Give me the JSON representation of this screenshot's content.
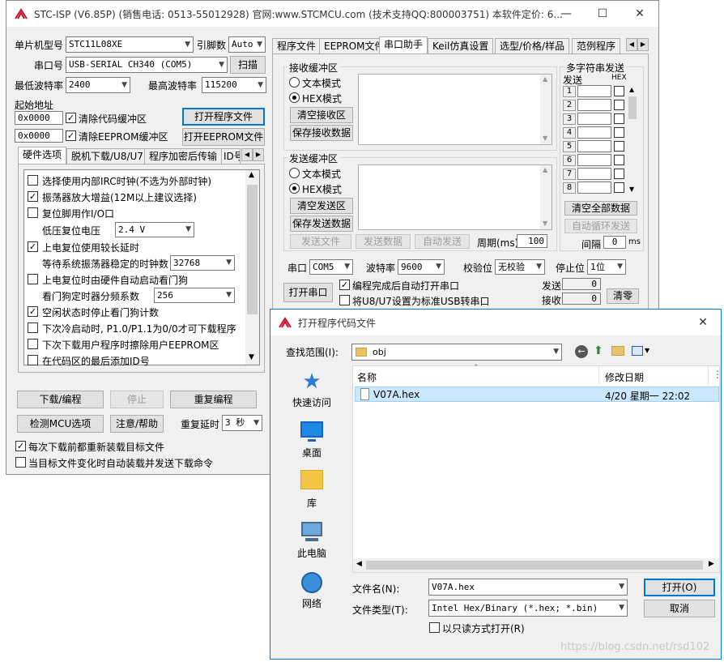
{
  "main_window": {
    "title": "STC-ISP (V6.85P) (销售电话: 0513-55012928) 官网:www.STCMCU.com  (技术支持QQ:800003751) 本软件定价: 6...",
    "mcu_type_label": "单片机型号",
    "mcu_type_value": "STC11L08XE",
    "pin_count_label": "引脚数",
    "pin_count_value": "Auto",
    "port_label": "串口号",
    "port_value": "USB-SERIAL CH340 (COM5)",
    "scan_button": "扫描",
    "min_baud_label": "最低波特率",
    "min_baud_value": "2400",
    "max_baud_label": "最高波特率",
    "max_baud_value": "115200",
    "start_addr_label": "起始地址",
    "code_addr_value": "0x0000",
    "clear_code_label": "清除代码缓冲区",
    "open_program_button": "打开程序文件",
    "eeprom_addr_value": "0x0000",
    "clear_eeprom_label": "清除EEPROM缓冲区",
    "open_eeprom_button": "打开EEPROM文件",
    "left_tabs": [
      "硬件选项",
      "脱机下载/U8/U7",
      "程序加密后传输",
      "ID号"
    ],
    "options": [
      {
        "label": "选择使用内部IRC时钟(不选为外部时钟)",
        "checked": false
      },
      {
        "label": "振荡器放大增益(12M以上建议选择)",
        "checked": true
      },
      {
        "label": "复位脚用作I/O口",
        "checked": false
      },
      {
        "label": "上电复位使用较长延时",
        "checked": true
      },
      {
        "label": "上电复位时由硬件自动启动看门狗",
        "checked": false
      },
      {
        "label": "空闲状态时停止看门狗计数",
        "checked": true
      },
      {
        "label": "下次冷启动时, P1.0/P1.1为0/0才可下载程序",
        "checked": false
      },
      {
        "label": "下次下载用户程序时擦除用户EEPROM区",
        "checked": false
      },
      {
        "label": "在代码区的最后添加ID号",
        "checked": false
      }
    ],
    "low_voltage_label": "低压复位电压",
    "low_voltage_value": "2.4 V",
    "osc_wait_label": "等待系统振荡器稳定的时钟数",
    "osc_wait_value": "32768",
    "wdt_div_label": "看门狗定时器分频系数",
    "wdt_div_value": "256",
    "download_button": "下载/编程",
    "stop_button": "停止",
    "reprogram_button": "重复编程",
    "check_mcu_button": "检测MCU选项",
    "help_button": "注意/帮助",
    "repeat_delay_label": "重复延时",
    "repeat_delay_value": "3 秒",
    "reload_each_label": "每次下载前都重新装载目标文件",
    "auto_reload_label": "当目标文件变化时自动装载并发送下载命令",
    "right_tabs": [
      "程序文件",
      "EEPROM文件",
      "串口助手",
      "Keil仿真设置",
      "选型/价格/样品",
      "范例程序"
    ],
    "receive_group": "接收缓冲区",
    "text_mode": "文本模式",
    "hex_mode": "HEX模式",
    "clear_receive_button": "清空接收区",
    "save_receive_button": "保存接收数据",
    "send_group": "发送缓冲区",
    "clear_send_button": "清空发送区",
    "save_send_button": "保存发送数据",
    "send_file_button": "发送文件",
    "send_data_button": "发送数据",
    "auto_send_button": "自动发送",
    "period_label": "周期(ms)",
    "period_value": "100",
    "multi_group": "多字符串发送",
    "multi_send_col": "发送",
    "multi_hex_col": "HEX",
    "multi_rows": [
      "1",
      "2",
      "3",
      "4",
      "5",
      "6",
      "7",
      "8"
    ],
    "clear_all_button": "清空全部数据",
    "auto_loop_button": "自动循环发送",
    "interval_label": "间隔",
    "interval_value": "0",
    "interval_unit": "ms",
    "com_label": "串口",
    "com_value": "COM5",
    "baud_label": "波特率",
    "baud_value": "9600",
    "parity_label": "校验位",
    "parity_value": "无校验",
    "stop_bits_label": "停止位",
    "stop_bits_value": "1位",
    "open_port_button": "打开串口",
    "auto_open_label": "编程完成后自动打开串口",
    "usb_label": "将U8/U7设置为标准USB转串口",
    "send_count_label": "发送",
    "send_count_value": "0",
    "recv_count_label": "接收",
    "recv_count_value": "0",
    "clear_count_button": "清零"
  },
  "dialog": {
    "title": "打开程序代码文件",
    "look_in_label": "查找范围(I):",
    "look_in_value": "obj",
    "nav": [
      "快速访问",
      "桌面",
      "库",
      "此电脑",
      "网络"
    ],
    "col_name": "名称",
    "col_date": "修改日期",
    "files": [
      {
        "name": "V07A.hex",
        "date": "4/20 星期一 22:02"
      }
    ],
    "filename_label": "文件名(N):",
    "filename_value": "V07A.hex",
    "filetype_label": "文件类型(T):",
    "filetype_value": "Intel Hex/Binary (*.hex; *.bin)",
    "readonly_label": "以只读方式打开(R)",
    "open_button": "打开(O)",
    "cancel_button": "取消"
  },
  "watermark": "https://blog.csdn.net/rsd102",
  "colors": {
    "accent": "#0078d7",
    "selection": "#cce8ff",
    "icon_red": "#c8102e"
  }
}
